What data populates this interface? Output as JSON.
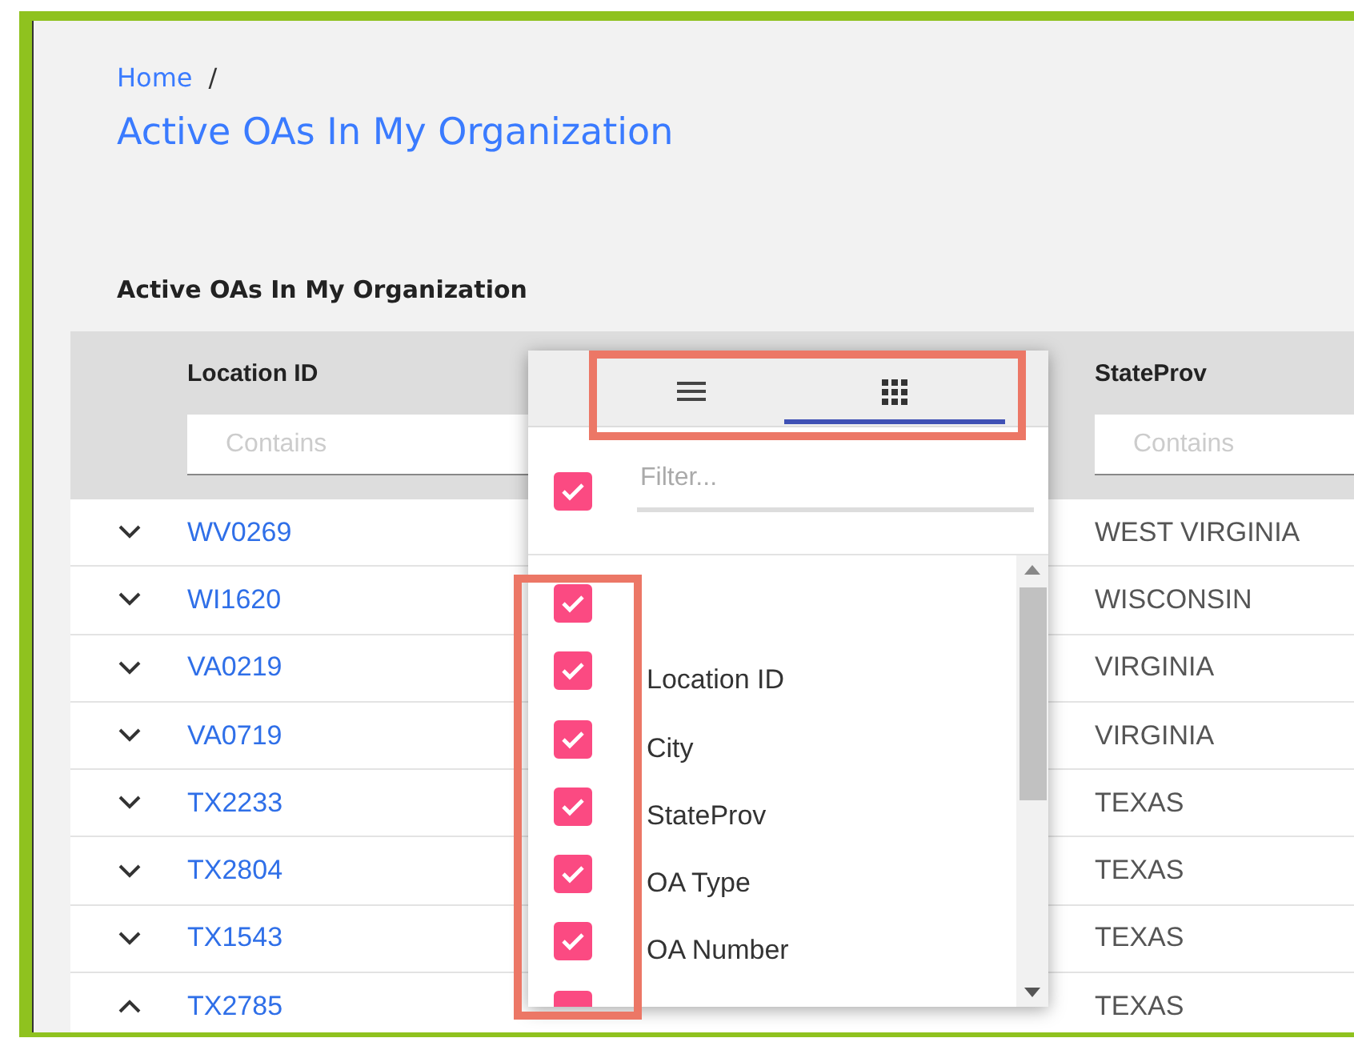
{
  "breadcrumb": {
    "items": [
      "Home"
    ],
    "separator": "/"
  },
  "title": "Active OAs In My Organization",
  "section_title": "Active OAs In My Organization",
  "table": {
    "columns": [
      "Location ID",
      "StateProv"
    ],
    "filters": [
      {
        "placeholder": "Contains"
      },
      {
        "placeholder": "Contains"
      }
    ],
    "rows": [
      {
        "location_id": "WV0269",
        "stateprov": "WEST VIRGINIA",
        "expanded": false
      },
      {
        "location_id": "WI1620",
        "stateprov": "WISCONSIN",
        "expanded": false
      },
      {
        "location_id": "VA0219",
        "stateprov": "VIRGINIA",
        "expanded": false
      },
      {
        "location_id": "VA0719",
        "stateprov": "VIRGINIA",
        "expanded": false
      },
      {
        "location_id": "TX2233",
        "stateprov": "TEXAS",
        "expanded": false
      },
      {
        "location_id": "TX2804",
        "stateprov": "TEXAS",
        "expanded": false
      },
      {
        "location_id": "TX1543",
        "stateprov": "TEXAS",
        "expanded": false
      },
      {
        "location_id": "TX2785",
        "stateprov": "TEXAS",
        "expanded": true
      }
    ]
  },
  "column_menu": {
    "tabs": [
      {
        "kind": "menu",
        "selected": false
      },
      {
        "kind": "columns",
        "selected": true
      }
    ],
    "select_all_checked": true,
    "filter": {
      "placeholder": "Filter..."
    },
    "columns": [
      {
        "checked": true
      },
      {
        "label": "Location ID",
        "checked": true
      },
      {
        "label": "City",
        "checked": true
      },
      {
        "label": "StateProv",
        "checked": true
      },
      {
        "label": "OA Type",
        "checked": true
      },
      {
        "label": "OA Number",
        "checked": true
      },
      {
        "checked": true
      }
    ]
  }
}
